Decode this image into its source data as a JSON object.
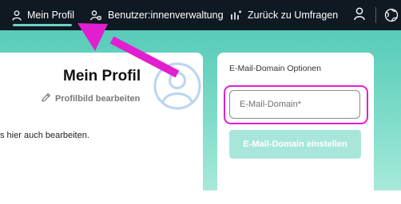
{
  "nav": {
    "profile_label": "Mein Profil",
    "users_label": "Benutzer:innenverwaltung",
    "back_label": "Zurück zu Umfragen",
    "active_color": "#6fd3c5"
  },
  "profile": {
    "title": "Mein Profil",
    "edit_picture": "Profilbild bearbeiten",
    "text": "s hier auch bearbeiten."
  },
  "domain": {
    "title": "E-Mail-Domain Optionen",
    "input_placeholder": "E-Mail-Domain*",
    "input_value": "",
    "button_label": "E-Mail-Domain einstellen",
    "button_state": "disabled"
  },
  "annotation": {
    "color": "#e21fd0"
  },
  "icons": [
    "person-icon",
    "user-gear-icon",
    "survey-icon",
    "user-account-icon",
    "globe-icon",
    "avatar-icon",
    "pencil-icon",
    "pointer-arrow"
  ]
}
